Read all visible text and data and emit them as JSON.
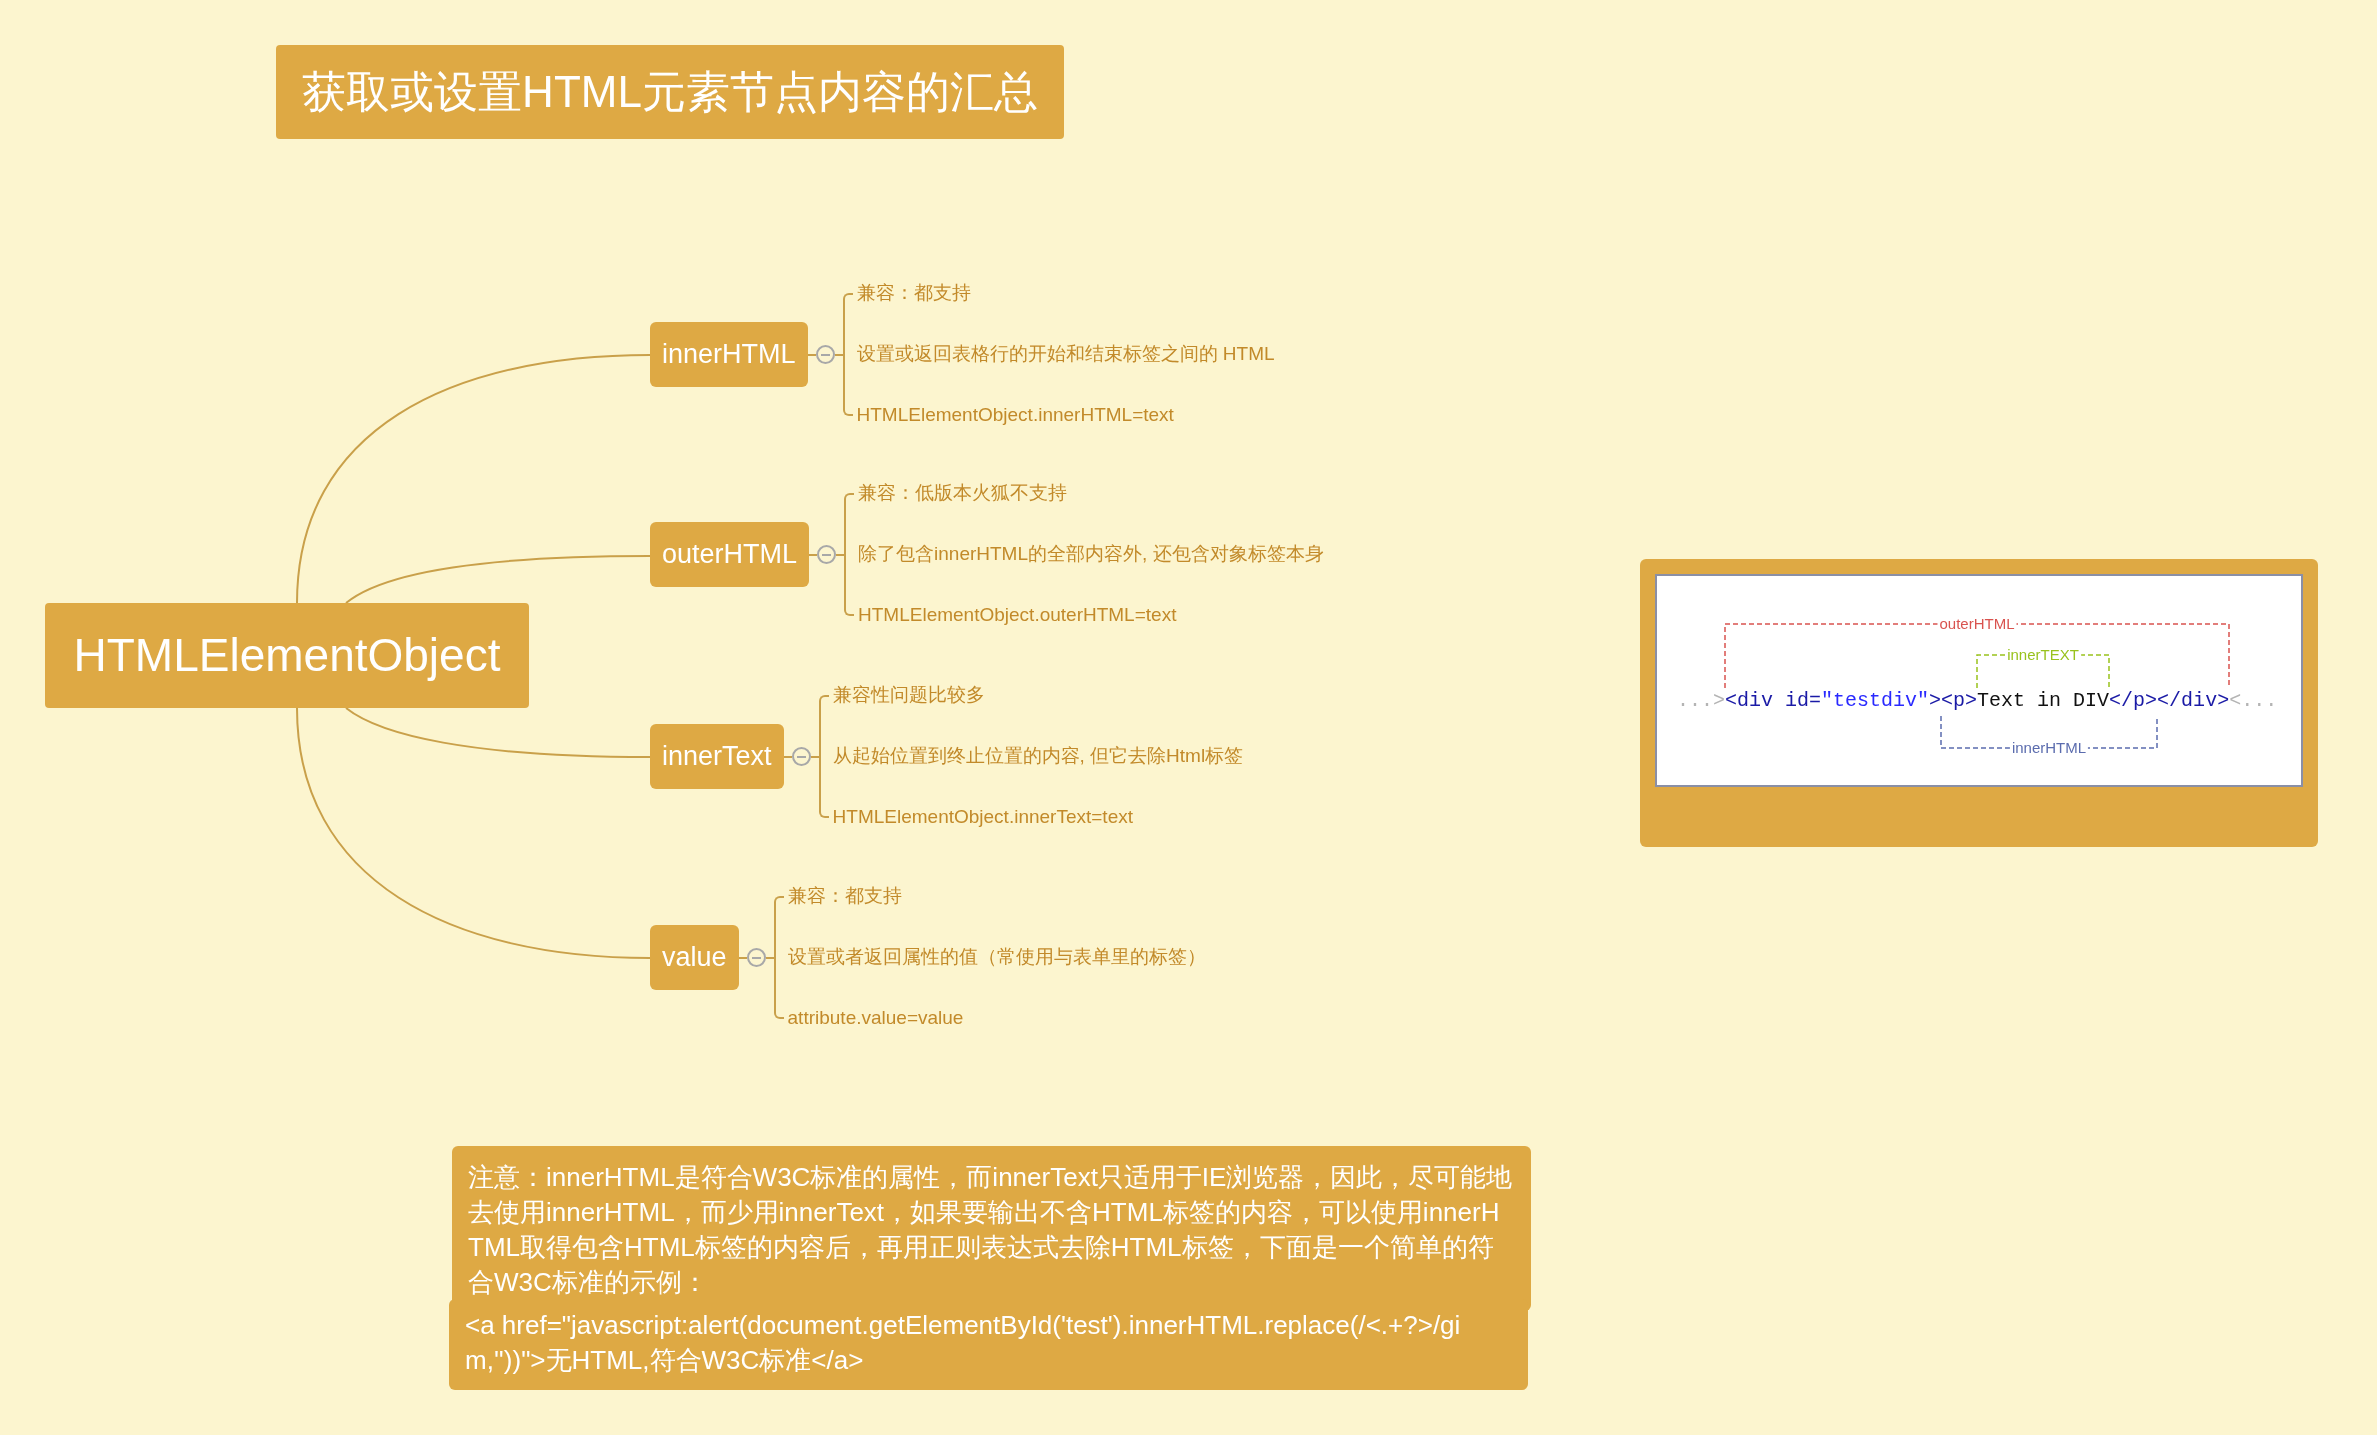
{
  "title": "获取或设置HTML元素节点内容的汇总",
  "root": {
    "label": "HTMLElementObject"
  },
  "branches": [
    {
      "label": "innerHTML",
      "expanded": true,
      "children": [
        {
          "label": "兼容：都支持"
        },
        {
          "label": "设置或返回表格行的开始和结束标签之间的 HTML"
        },
        {
          "label": "HTMLElementObject.innerHTML=text"
        }
      ]
    },
    {
      "label": "outerHTML",
      "expanded": true,
      "children": [
        {
          "label": "兼容：低版本火狐不支持"
        },
        {
          "label": "除了包含innerHTML的全部内容外, 还包含对象标签本身"
        },
        {
          "label": "HTMLElementObject.outerHTML=text"
        }
      ]
    },
    {
      "label": "innerText",
      "expanded": true,
      "children": [
        {
          "label": "兼容性问题比较多"
        },
        {
          "label": "从起始位置到终止位置的内容, 但它去除Html标签"
        },
        {
          "label": "HTMLElementObject.innerText=text"
        }
      ]
    },
    {
      "label": "value",
      "expanded": true,
      "children": [
        {
          "label": "兼容：都支持"
        },
        {
          "label": "设置或者返回属性的值（常使用与表单里的标签）"
        },
        {
          "label": "attribute.value=value"
        }
      ]
    }
  ],
  "diagram": {
    "code": [
      {
        "text": "...>",
        "color": "#b4b4b4"
      },
      {
        "text": "<div id=",
        "color": "#1a1aa6"
      },
      {
        "text": "\"testdiv\"",
        "color": "#2a2aff"
      },
      {
        "text": "><p>",
        "color": "#1a1aa6"
      },
      {
        "text": "Text in DIV",
        "color": "#111111"
      },
      {
        "text": "</p></div>",
        "color": "#1a1aa6"
      },
      {
        "text": "<...",
        "color": "#b4b4b4"
      }
    ],
    "labels": [
      {
        "text": "outerHTML",
        "color": "#d9534f"
      },
      {
        "text": "innerTEXT",
        "color": "#99c21d"
      },
      {
        "text": "innerHTML",
        "color": "#5b6cae"
      }
    ]
  },
  "note": {
    "text": "注意：innerHTML是符合W3C标准的属性，而innerText只适用于IE浏览器，因此，尽可能地去使用innerHTML，而少用innerText，如果要输出不含HTML标签的内容，可以使用innerHTML取得包含HTML标签的内容后，再用正则表达式去除HTML标签，下面是一个简单的符合W3C标准的示例：",
    "code": "<a href=\"javascript:alert(document.getElementById('test').innerHTML.replace(/<.+?>/gim,''))\">无HTML,符合W3C标准</a>"
  }
}
